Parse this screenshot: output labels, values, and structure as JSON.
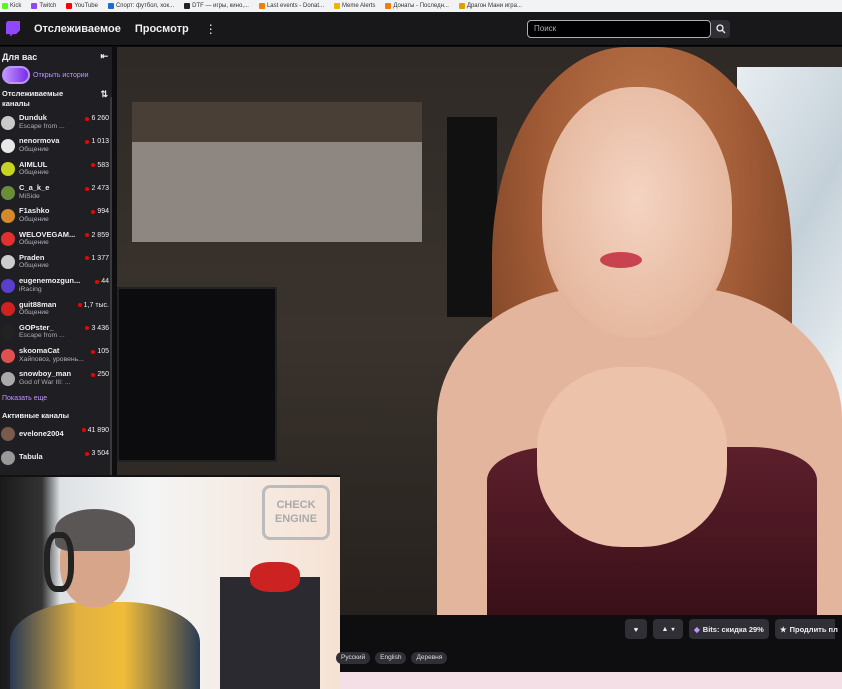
{
  "bookmarks": [
    {
      "label": "Kick",
      "color": "#53fc18"
    },
    {
      "label": "Twitch",
      "color": "#9147ff"
    },
    {
      "label": "YouTube",
      "color": "#ff0000"
    },
    {
      "label": "Спорт: футбол, хок...",
      "color": "#1e6bd6"
    },
    {
      "label": "DTF — игры, кино,...",
      "color": "#222222"
    },
    {
      "label": "Last events - Donat...",
      "color": "#f57d07"
    },
    {
      "label": "Meme Alerts",
      "color": "#f0b400"
    },
    {
      "label": "Донаты - Последн...",
      "color": "#f57d07"
    },
    {
      "label": "Драгон Мани игра...",
      "color": "#e0a000"
    }
  ],
  "nav": {
    "following": "Отслеживаемое",
    "browse": "Просмотр",
    "more": "⋮",
    "search_placeholder": "Поиск"
  },
  "sidebar": {
    "title": "Для вас",
    "collapse_icon": "⇤",
    "stories_label": "Открыть истории",
    "followed_header": "Отслеживаемые каналы",
    "sort_icon": "⇅",
    "channels": [
      {
        "name": "Dunduk",
        "game": "Escape from ...",
        "viewers": "6 260",
        "color": "#c9c9c9"
      },
      {
        "name": "nenormova",
        "game": "Общение",
        "viewers": "1 013",
        "color": "#e8e8e8"
      },
      {
        "name": "AIMLUL",
        "game": "Общение",
        "viewers": "583",
        "color": "#c6d320"
      },
      {
        "name": "C_a_k_e",
        "game": "MiSide",
        "viewers": "2 473",
        "color": "#6b8d3a"
      },
      {
        "name": "F1ashko",
        "game": "Общение",
        "viewers": "994",
        "color": "#d28a2d"
      },
      {
        "name": "WELOVEGAM...",
        "game": "Общение",
        "viewers": "2 859",
        "color": "#e03030"
      },
      {
        "name": "Praden",
        "game": "Общение",
        "viewers": "1 377",
        "color": "#cccccc"
      },
      {
        "name": "eugenemozgun...",
        "game": "iRacing",
        "viewers": "44",
        "color": "#5a3fcf"
      },
      {
        "name": "guit88man",
        "game": "Общение",
        "viewers": "1,7 тыс.",
        "color": "#d02020"
      },
      {
        "name": "GOPster_",
        "game": "Escape from ...",
        "viewers": "3 436",
        "color": "#222222"
      },
      {
        "name": "skoomaCat",
        "game": "Хайповоз, уровень...",
        "viewers": "105",
        "color": "#e05050"
      },
      {
        "name": "snowboy_man",
        "game": "God of War III: ...",
        "viewers": "250",
        "color": "#aaaaaa"
      }
    ],
    "show_more": "Показать еще",
    "active_header": "Активные каналы",
    "active": [
      {
        "name": "evelone2004",
        "game": "",
        "viewers": "41 890",
        "color": "#7a5a4a"
      },
      {
        "name": "Tabula",
        "game": "",
        "viewers": "3 504",
        "color": "#999999"
      }
    ]
  },
  "stream": {
    "webcam_sign": "CHECK ENGINE",
    "actions": {
      "heart_icon": "♥",
      "notify_icon": "🔔",
      "bits_label": "Bits: скидка 29%",
      "extend_label": "Продлить пл"
    },
    "tags": [
      "Русский",
      "English",
      "Деревня"
    ]
  }
}
